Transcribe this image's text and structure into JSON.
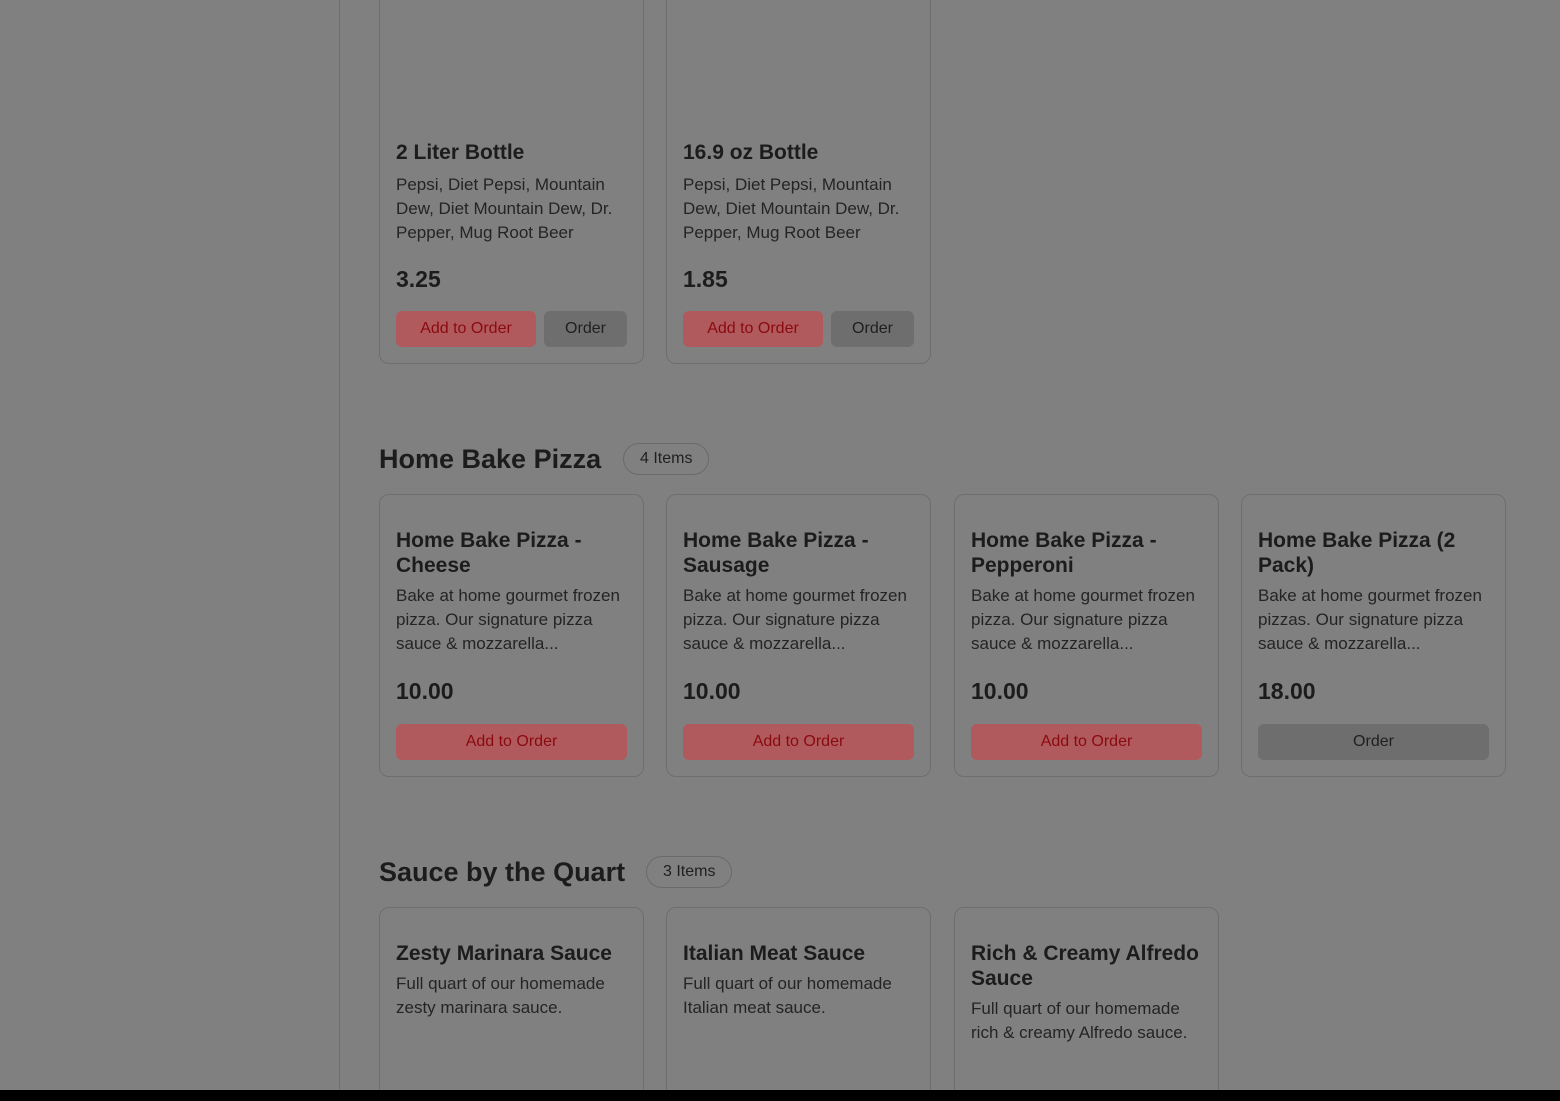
{
  "sections": {
    "drinks": {
      "items": [
        {
          "title": "2 Liter Bottle",
          "desc": "Pepsi, Diet Pepsi, Mountain Dew, Diet Mountain Dew, Dr. Pepper, Mug Root Beer",
          "price": "3.25",
          "add_label": "Add to Order",
          "order_label": "Order"
        },
        {
          "title": "16.9 oz Bottle",
          "desc": "Pepsi, Diet Pepsi, Mountain Dew, Diet Mountain Dew, Dr. Pepper, Mug Root Beer",
          "price": "1.85",
          "add_label": "Add to Order",
          "order_label": "Order"
        }
      ]
    },
    "home_bake_pizza": {
      "title": "Home Bake Pizza",
      "badge": "4 Items",
      "items": [
        {
          "title": "Home Bake Pizza - Cheese",
          "desc": "Bake at home gourmet frozen pizza. Our signature pizza sauce & mozzarella...",
          "price": "10.00",
          "button_label": "Add to Order"
        },
        {
          "title": "Home Bake Pizza - Sausage",
          "desc": "Bake at home gourmet frozen pizza. Our signature pizza sauce & mozzarella...",
          "price": "10.00",
          "button_label": "Add to Order"
        },
        {
          "title": "Home Bake Pizza - Pepperoni",
          "desc": "Bake at home gourmet frozen pizza. Our signature pizza sauce & mozzarella...",
          "price": "10.00",
          "button_label": "Add to Order"
        },
        {
          "title": "Home Bake Pizza (2 Pack)",
          "desc": "Bake at home gourmet frozen pizzas. Our signature pizza sauce & mozzarella...",
          "price": "18.00",
          "button_label": "Order"
        }
      ]
    },
    "sauce_by_quart": {
      "title": "Sauce by the Quart",
      "badge": "3 Items",
      "items": [
        {
          "title": "Zesty Marinara Sauce",
          "desc": "Full quart of our homemade zesty marinara sauce."
        },
        {
          "title": "Italian Meat Sauce",
          "desc": "Full quart of our homemade Italian meat sauce."
        },
        {
          "title": "Rich & Creamy Alfredo Sauce",
          "desc": "Full quart of our homemade rich & creamy Alfredo sauce."
        }
      ]
    }
  },
  "colors": {
    "overlay": "#808080",
    "add_button_bg": "#b05a5e",
    "add_button_text": "#8a0a10",
    "order_button_bg": "#6e6e6e"
  }
}
